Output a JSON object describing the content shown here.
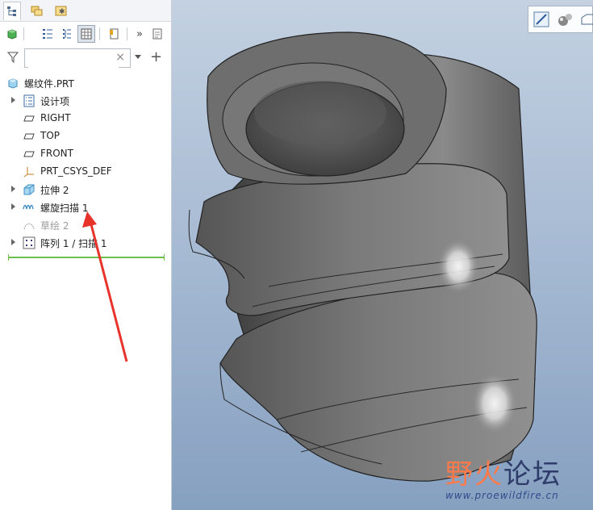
{
  "sidebar": {
    "tabs": [
      {
        "icon": "model-tree-icon",
        "active": true
      },
      {
        "icon": "folder-browser-icon",
        "active": false
      },
      {
        "icon": "favorites-icon",
        "active": false
      }
    ],
    "toolbar_icons": [
      "cube-display-icon",
      "tree-columns-icon",
      "tree-filters-icon",
      "tree-settings-icon",
      "bookmark-icon",
      "more-icon",
      "notes-icon"
    ],
    "search": {
      "value": "",
      "clear_symbol": "×"
    },
    "filter_icon": "filter-icon",
    "add_symbol": "+",
    "tree": {
      "root": {
        "label": "螺纹件.PRT",
        "icon": "part-icon"
      },
      "items": [
        {
          "label": "设计项",
          "icon": "design-items-icon",
          "expandable": true,
          "suppressed": false
        },
        {
          "label": "RIGHT",
          "icon": "datum-plane-icon",
          "expandable": false,
          "suppressed": false
        },
        {
          "label": "TOP",
          "icon": "datum-plane-icon",
          "expandable": false,
          "suppressed": false
        },
        {
          "label": "FRONT",
          "icon": "datum-plane-icon",
          "expandable": false,
          "suppressed": false
        },
        {
          "label": "PRT_CSYS_DEF",
          "icon": "coordinate-system-icon",
          "expandable": false,
          "suppressed": false
        },
        {
          "label": "拉伸 2",
          "icon": "extrude-icon",
          "expandable": true,
          "suppressed": false
        },
        {
          "label": "螺旋扫描 1",
          "icon": "helical-sweep-icon",
          "expandable": true,
          "suppressed": false
        },
        {
          "label": "草绘 2",
          "icon": "sketch-icon",
          "expandable": false,
          "suppressed": true
        },
        {
          "label": "阵列 1 / 扫描 1",
          "icon": "pattern-icon",
          "expandable": true,
          "suppressed": false
        }
      ]
    }
  },
  "viewport": {
    "toolbar_icons": [
      "view-orientation-icon",
      "shading-icon",
      "view-cube-icon"
    ],
    "watermark": {
      "title_part1": "野火",
      "title_part2": "论坛",
      "url": "www.proewildfire.cn"
    }
  },
  "colors": {
    "annotation_arrow": "#e8332a",
    "insert_line": "#6cc04a",
    "model": "#6e6e6e"
  }
}
